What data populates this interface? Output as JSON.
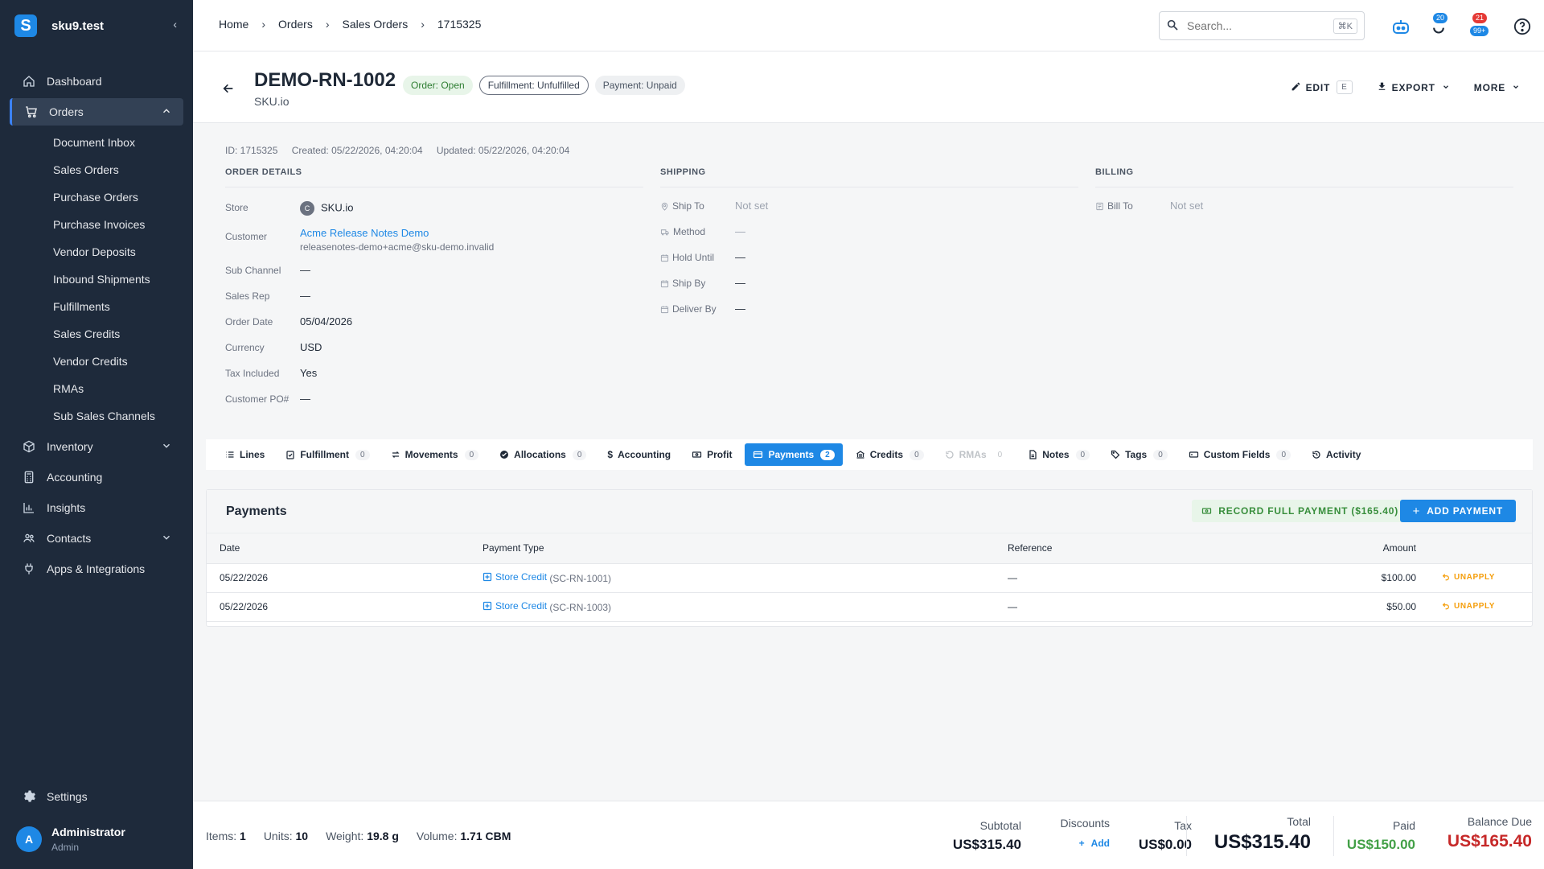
{
  "app": {
    "name": "sku9.test",
    "logo_letter": "S"
  },
  "sidebar": {
    "items": [
      {
        "label": "Dashboard",
        "icon": "home-icon"
      },
      {
        "label": "Orders",
        "icon": "cart-icon"
      },
      {
        "label": "Inventory",
        "icon": "cube-icon"
      },
      {
        "label": "Accounting",
        "icon": "calculator-icon"
      },
      {
        "label": "Insights",
        "icon": "bar-chart-icon"
      },
      {
        "label": "Contacts",
        "icon": "people-icon"
      },
      {
        "label": "Apps & Integrations",
        "icon": "plug-icon"
      }
    ],
    "orders_sub": [
      "Document Inbox",
      "Sales Orders",
      "Purchase Orders",
      "Purchase Invoices",
      "Vendor Deposits",
      "Inbound Shipments",
      "Fulfillments",
      "Sales Credits",
      "Vendor Credits",
      "RMAs",
      "Sub Sales Channels"
    ],
    "settings": "Settings",
    "user": {
      "initial": "A",
      "name": "Administrator",
      "role": "Admin"
    }
  },
  "topbar": {
    "breadcrumb": [
      "Home",
      "Orders",
      "Sales Orders",
      "1715325"
    ],
    "search_placeholder": "Search...",
    "search_shortcut": "⌘K",
    "badge_bot": "20",
    "badge_alert_top": "21",
    "badge_alert_bottom": "99+"
  },
  "header": {
    "order_number": "DEMO-RN-1002",
    "store": "SKU.io",
    "chips": {
      "order": "Order: Open",
      "fulfillment": "Fulfillment: Unfulfilled",
      "payment": "Payment: Unpaid"
    },
    "edit": "EDIT",
    "edit_key": "E",
    "export": "EXPORT",
    "more": "MORE"
  },
  "meta": {
    "id": "ID: 1715325",
    "created": "Created: 05/22/2026, 04:20:04",
    "updated": "Updated: 05/22/2026, 04:20:04"
  },
  "order_details": {
    "title": "ORDER DETAILS",
    "store_label": "Store",
    "store_initial": "C",
    "store": "SKU.io",
    "customer_label": "Customer",
    "customer": "Acme Release Notes Demo",
    "customer_email": "releasenotes-demo+acme@sku-demo.invalid",
    "sub_channel_label": "Sub Channel",
    "sub_channel": "—",
    "sales_rep_label": "Sales Rep",
    "sales_rep": "—",
    "order_date_label": "Order Date",
    "order_date": "05/04/2026",
    "currency_label": "Currency",
    "currency": "USD",
    "tax_label": "Tax Included",
    "tax": "Yes",
    "po_label": "Customer PO#",
    "po": "—"
  },
  "shipping": {
    "title": "SHIPPING",
    "ship_to_label": "Ship To",
    "ship_to": "Not set",
    "method_label": "Method",
    "method": "—",
    "hold_label": "Hold Until",
    "hold": "—",
    "ship_by_label": "Ship By",
    "ship_by": "—",
    "deliver_label": "Deliver By",
    "deliver": "—"
  },
  "billing": {
    "title": "BILLING",
    "bill_to_label": "Bill To",
    "bill_to": "Not set"
  },
  "tabs": [
    {
      "label": "Lines",
      "count": ""
    },
    {
      "label": "Fulfillment",
      "count": "0"
    },
    {
      "label": "Movements",
      "count": "0"
    },
    {
      "label": "Allocations",
      "count": "0"
    },
    {
      "label": "Accounting",
      "count": ""
    },
    {
      "label": "Profit",
      "count": ""
    },
    {
      "label": "Payments",
      "count": "2"
    },
    {
      "label": "Credits",
      "count": "0"
    },
    {
      "label": "RMAs",
      "count": "0"
    },
    {
      "label": "Notes",
      "count": "0"
    },
    {
      "label": "Tags",
      "count": "0"
    },
    {
      "label": "Custom Fields",
      "count": "0"
    },
    {
      "label": "Activity",
      "count": ""
    }
  ],
  "payments": {
    "title": "Payments",
    "record_full": "RECORD FULL PAYMENT ($165.40)",
    "add": "ADD PAYMENT",
    "columns": [
      "Date",
      "Payment Type",
      "Reference",
      "Amount"
    ],
    "rows": [
      {
        "date": "05/22/2026",
        "type": "Store Credit",
        "type_ref": "(SC-RN-1001)",
        "reference": "—",
        "amount": "$100.00",
        "action": "UNAPPLY"
      },
      {
        "date": "05/22/2026",
        "type": "Store Credit",
        "type_ref": "(SC-RN-1003)",
        "reference": "—",
        "amount": "$50.00",
        "action": "UNAPPLY"
      }
    ]
  },
  "footer": {
    "items_label": "Items:",
    "items": "1",
    "units_label": "Units:",
    "units": "10",
    "weight_label": "Weight:",
    "weight": "19.8 g",
    "volume_label": "Volume:",
    "volume": "1.71 CBM",
    "subtotal_label": "Subtotal",
    "subtotal": "US$315.40",
    "discounts_label": "Discounts",
    "discounts_add": "Add",
    "tax_label": "Tax",
    "tax": "US$0.00",
    "total_label": "Total",
    "total": "US$315.40",
    "paid_label": "Paid",
    "paid": "US$150.00",
    "balance_label": "Balance Due",
    "balance": "US$165.40"
  },
  "colors": {
    "accent": "#1e88e5",
    "sidebar": "#1e2a3b",
    "paid": "#43a047",
    "balance": "#c62828",
    "unapply": "#f59e0b"
  }
}
